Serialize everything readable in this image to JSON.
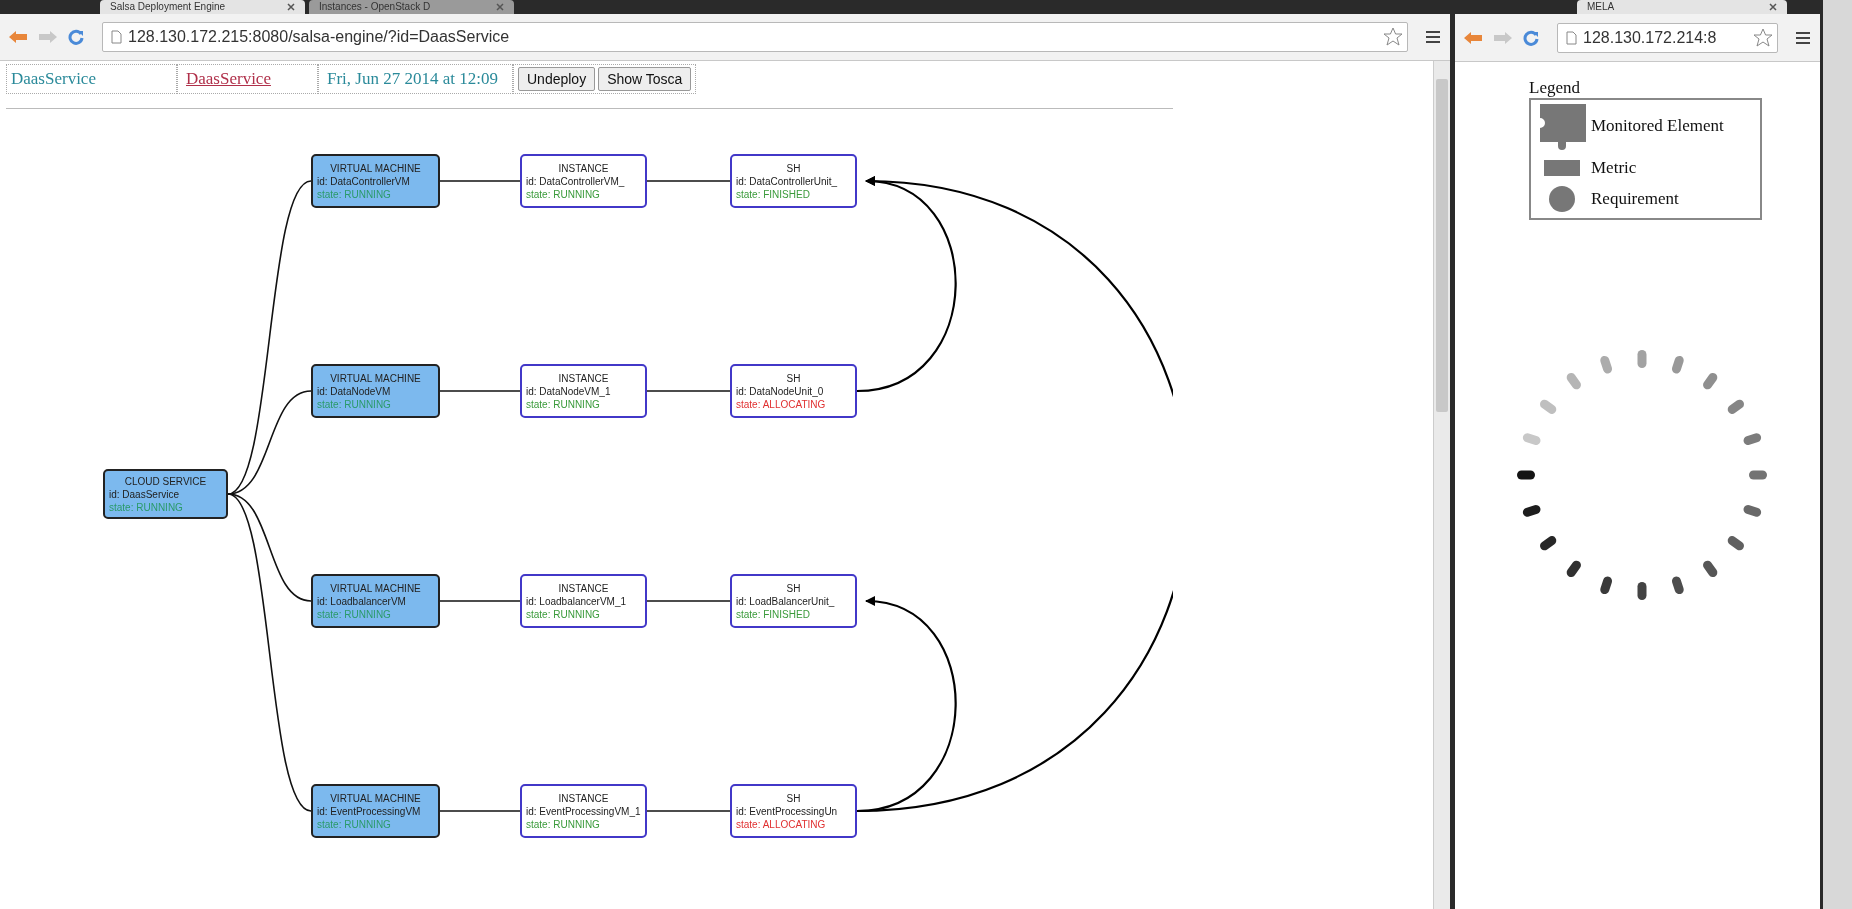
{
  "left_window": {
    "tabs": [
      {
        "label": "Salsa Deployment Engine",
        "selected": true
      },
      {
        "label": "Instances - OpenStack D",
        "selected": false
      }
    ],
    "address": "128.130.172.215:8080/salsa-engine/?id=DaasService",
    "header": {
      "service": "DaasService",
      "link": "DaasService",
      "date": "Fri, Jun 27 2014 at 12:09",
      "buttons": [
        "Undeploy",
        "Show Tosca"
      ]
    },
    "diagram": {
      "root": {
        "kind": "cloud",
        "title": "CLOUD SERVICE",
        "id": "id: DaasService",
        "state": "state: RUNNING",
        "color": "#2a9a6a"
      },
      "rows": [
        [
          {
            "kind": "vm",
            "title": "VIRTUAL MACHINE",
            "id": "id: DataControllerVM",
            "state": "state: RUNNING",
            "color": "#2a9a6a"
          },
          {
            "kind": "instance",
            "title": "INSTANCE",
            "id": "id: DataControllerVM_",
            "state": "state: RUNNING",
            "color": "#3a9a3a"
          },
          {
            "kind": "sh",
            "title": "SH",
            "id": "id: DataControllerUnit_",
            "state": "state: FINISHED",
            "color": "#3a9a3a"
          }
        ],
        [
          {
            "kind": "vm",
            "title": "VIRTUAL MACHINE",
            "id": "id: DataNodeVM",
            "state": "state: RUNNING",
            "color": "#2a9a6a"
          },
          {
            "kind": "instance",
            "title": "INSTANCE",
            "id": "id: DataNodeVM_1",
            "state": "state: RUNNING",
            "color": "#3a9a3a"
          },
          {
            "kind": "sh",
            "title": "SH",
            "id": "id: DataNodeUnit_0",
            "state": "state: ALLOCATING",
            "color": "#e03030"
          }
        ],
        [
          {
            "kind": "vm",
            "title": "VIRTUAL MACHINE",
            "id": "id: LoadbalancerVM",
            "state": "state: RUNNING",
            "color": "#2a9a6a"
          },
          {
            "kind": "instance",
            "title": "INSTANCE",
            "id": "id: LoadbalancerVM_1",
            "state": "state: RUNNING",
            "color": "#3a9a3a"
          },
          {
            "kind": "sh",
            "title": "SH",
            "id": "id: LoadBalancerUnit_",
            "state": "state: FINISHED",
            "color": "#3a9a3a"
          }
        ],
        [
          {
            "kind": "vm",
            "title": "VIRTUAL MACHINE",
            "id": "id: EventProcessingVM",
            "state": "state: RUNNING",
            "color": "#2a9a6a"
          },
          {
            "kind": "instance",
            "title": "INSTANCE",
            "id": "id: EventProcessingVM_1",
            "state": "state: RUNNING",
            "color": "#3a9a3a"
          },
          {
            "kind": "sh",
            "title": "SH",
            "id": "id: EventProcessingUn",
            "state": "state: ALLOCATING",
            "color": "#e03030"
          }
        ]
      ],
      "arrows": [
        {
          "kind": "arrow"
        },
        {
          "kind": "arrow"
        },
        {
          "kind": "arrow"
        }
      ]
    }
  },
  "right_window": {
    "tabs": [
      {
        "label": "MELA",
        "selected": true
      }
    ],
    "address": "128.130.172.214:8",
    "legend": {
      "title": "Legend",
      "items": [
        {
          "kind": "element",
          "label": "Monitored Element"
        },
        {
          "kind": "metric",
          "label": "Metric"
        },
        {
          "kind": "requirement",
          "label": "Requirement"
        }
      ]
    }
  }
}
